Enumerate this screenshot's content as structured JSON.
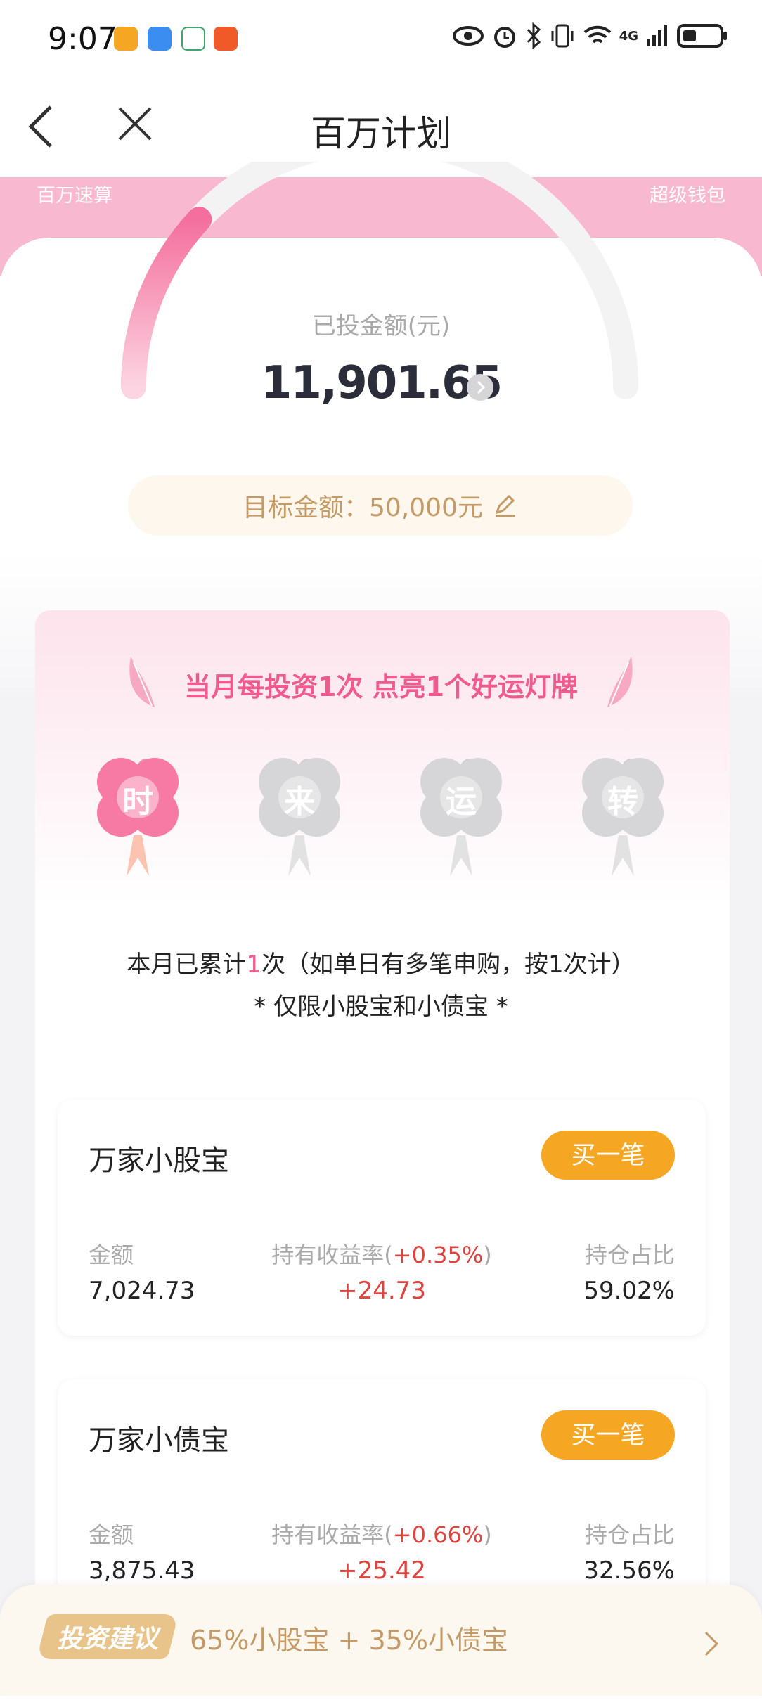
{
  "status_bar": {
    "time": "9:07",
    "network": "4G"
  },
  "nav": {
    "title": "百万计划"
  },
  "hero": {
    "left_tag": "百万速算",
    "right_tag": "超级钱包",
    "invested_label": "已投金额(元)",
    "invested_amount": "11,901.65",
    "target_text": "目标金额：50,000元",
    "progress_fraction": 0.238
  },
  "lucky": {
    "title": "当月每投资1次 点亮1个好运灯牌",
    "clovers": [
      {
        "char": "时",
        "lit": true
      },
      {
        "char": "来",
        "lit": false
      },
      {
        "char": "运",
        "lit": false
      },
      {
        "char": "转",
        "lit": false
      }
    ],
    "count_prefix": "本月已累计",
    "count_value": "1",
    "count_suffix": "次（如单日有多笔申购，按1次计）",
    "limit_note": "* 仅限小股宝和小债宝 *"
  },
  "funds": [
    {
      "name": "万家小股宝",
      "buy_label": "买一笔",
      "amount_label": "金额",
      "amount": "7,024.73",
      "yield_label_prefix": "持有收益率(",
      "yield_rate": "+0.35%",
      "yield_label_suffix": ")",
      "profit": "+24.73",
      "share_label": "持仓占比",
      "share": "59.02%"
    },
    {
      "name": "万家小债宝",
      "buy_label": "买一笔",
      "amount_label": "金额",
      "amount": "3,875.43",
      "yield_label_prefix": "持有收益率(",
      "yield_rate": "+0.66%",
      "yield_label_suffix": ")",
      "profit": "+25.42",
      "share_label": "持仓占比",
      "share": "32.56%"
    }
  ],
  "bottom": {
    "advice_label": "投资建议",
    "advice_text": "65%小股宝 + 35%小债宝"
  },
  "colors": {
    "pink": "#ef5b8e",
    "orange": "#f5a623",
    "gold": "#c49a67",
    "red": "#e0423d"
  }
}
